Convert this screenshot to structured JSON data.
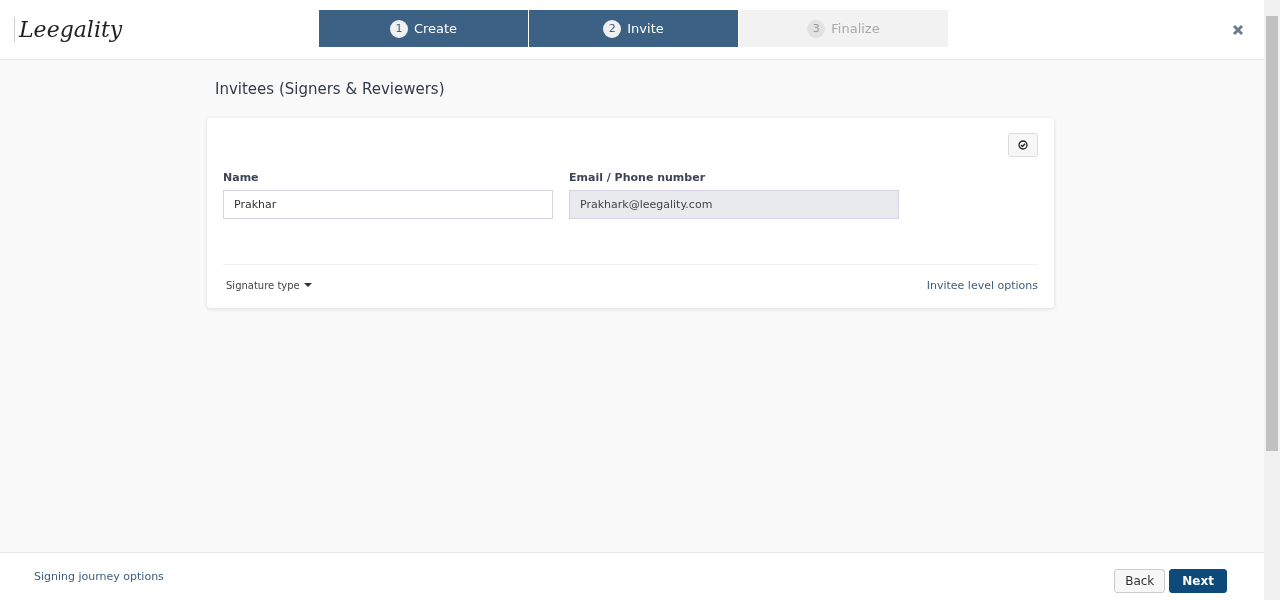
{
  "logo": "Leegality",
  "steps": [
    {
      "number": "1",
      "label": "Create",
      "disabled": false
    },
    {
      "number": "2",
      "label": "Invite",
      "disabled": false
    },
    {
      "number": "3",
      "label": "Finalize",
      "disabled": true
    }
  ],
  "section_title": "Invitees (Signers & Reviewers)",
  "invitee": {
    "name_label": "Name",
    "name_value": "Prakhar",
    "email_label": "Email / Phone number",
    "email_value": "Prakhark@leegality.com",
    "email_disabled": true,
    "signature_type": "Signature type",
    "options_link": "Invitee level options"
  },
  "footer": {
    "link": "Signing journey options",
    "buttons": [
      {
        "label": "Back",
        "kind": "secondary"
      },
      {
        "label": "Next",
        "kind": "primary"
      }
    ]
  }
}
